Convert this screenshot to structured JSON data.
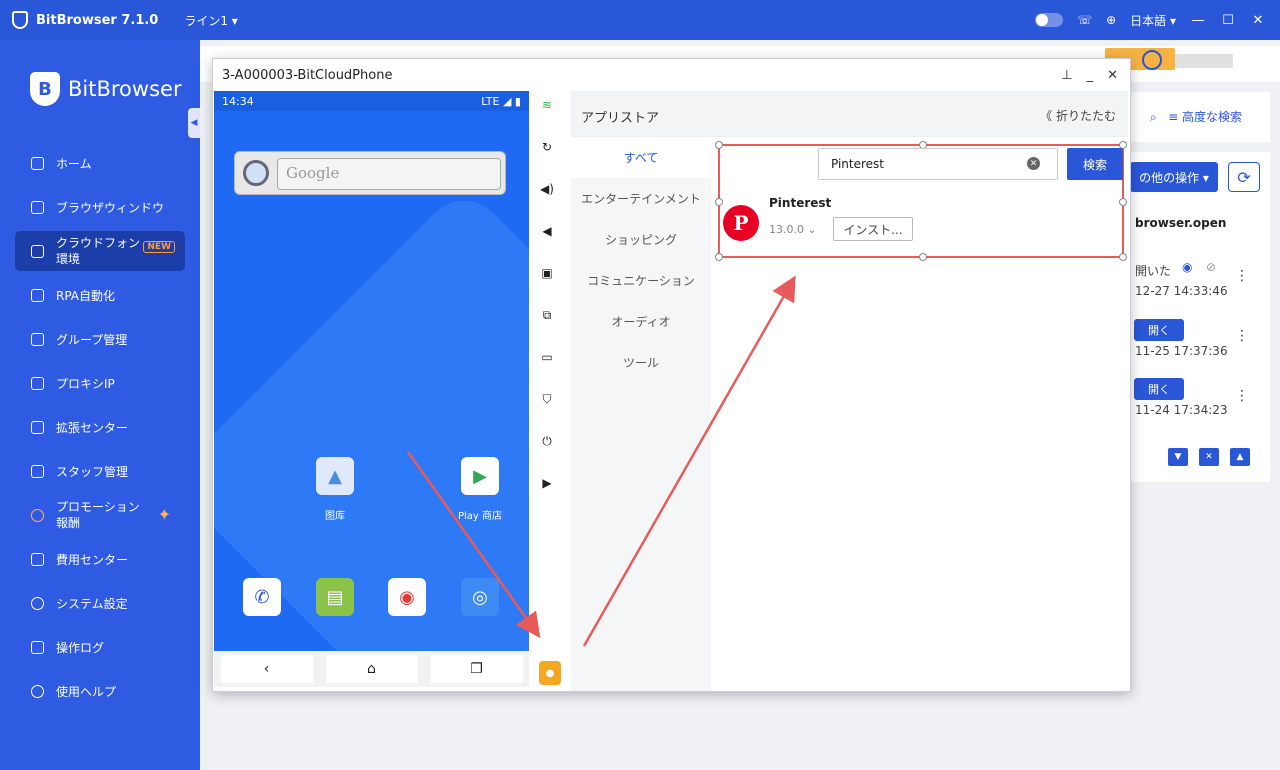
{
  "topbar": {
    "app_title": "BitBrowser 7.1.0",
    "line_select": "ライン1 ▾",
    "language": "日本語 ▾"
  },
  "sidebar": {
    "brand": "BitBrowser",
    "items": [
      {
        "label": "ホーム",
        "icon": "home-icon"
      },
      {
        "label": "ブラウザウィンドウ",
        "icon": "grid-icon"
      },
      {
        "label": "クラウドフォン\n環境",
        "icon": "cloud-icon",
        "badge": "NEW"
      },
      {
        "label": "RPA自動化",
        "icon": "robot-icon"
      },
      {
        "label": "グループ管理",
        "icon": "layers-icon"
      },
      {
        "label": "プロキシIP",
        "icon": "location-icon"
      },
      {
        "label": "拡張センター",
        "icon": "cube-icon"
      },
      {
        "label": "スタッフ管理",
        "icon": "users-icon"
      },
      {
        "label": "プロモーション\n報酬",
        "icon": "coin-icon"
      },
      {
        "label": "費用センター",
        "icon": "wallet-icon"
      },
      {
        "label": "システム設定",
        "icon": "gear-icon"
      },
      {
        "label": "操作ログ",
        "icon": "log-icon"
      },
      {
        "label": "使用ヘルプ",
        "icon": "help-icon"
      }
    ]
  },
  "background": {
    "advanced_search": "高度な検索",
    "more_ops": "の他の操作 ▾",
    "column_header": "browser.open",
    "rows": [
      {
        "status": "開いた",
        "time": "12-27 14:33:46"
      },
      {
        "button": "開く",
        "time": "11-25 17:37:36"
      },
      {
        "button": "開く",
        "time": "11-24 17:34:23"
      }
    ]
  },
  "dialog": {
    "title": "3-A000003-BitCloudPhone",
    "phone": {
      "time": "14:34",
      "network": "LTE",
      "google_placeholder": "Google",
      "apps": [
        "图库",
        "Play 商店"
      ]
    },
    "store": {
      "title": "アプリストア",
      "fold": "《 折りたたむ",
      "categories": [
        "すべて",
        "エンターテインメント",
        "ショッピング",
        "コミュニケーション",
        "オーディオ",
        "ツール"
      ],
      "search_value": "Pinterest",
      "search_button": "検索",
      "result": {
        "name": "Pinterest",
        "version": "13.0.0",
        "install": "インスト..."
      }
    }
  },
  "colors": {
    "primary": "#2a56d8",
    "sidebar": "#2f5be3",
    "highlight": "#e85b5b",
    "pinterest": "#e60023"
  }
}
